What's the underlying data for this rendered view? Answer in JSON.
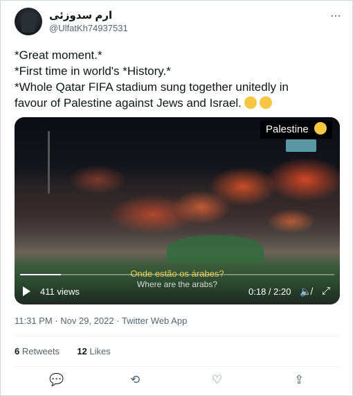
{
  "tweet": {
    "author_name": "ارم سدوزئی",
    "author_handle": "@UlfatKh74937531",
    "more_icon": "more-icon",
    "text_lines": [
      "*Great moment.*",
      "*First time in world's *History.*",
      "*Whole Qatar FIFA stadium sung together unitedly in",
      "favour of Palestine against Jews and Israel."
    ],
    "timestamp": "11:31 PM · Nov 29, 2022 · Twitter Web App",
    "retweets_count": "6",
    "retweets_label": "Retweets",
    "likes_count": "12",
    "likes_label": "Likes"
  },
  "video": {
    "overlay_label": "Palestine",
    "subtitle_pt": "Onde estão os árabes?",
    "subtitle_en": "Where are the arabs?",
    "views": "411 views",
    "time": "0:18 / 2:20",
    "progress": 0.13
  },
  "actions": [
    "reply-icon",
    "retweet-icon",
    "like-icon",
    "share-icon"
  ],
  "colors": {
    "muted": "#536471",
    "subtitle_yellow": "#e8c53b"
  }
}
